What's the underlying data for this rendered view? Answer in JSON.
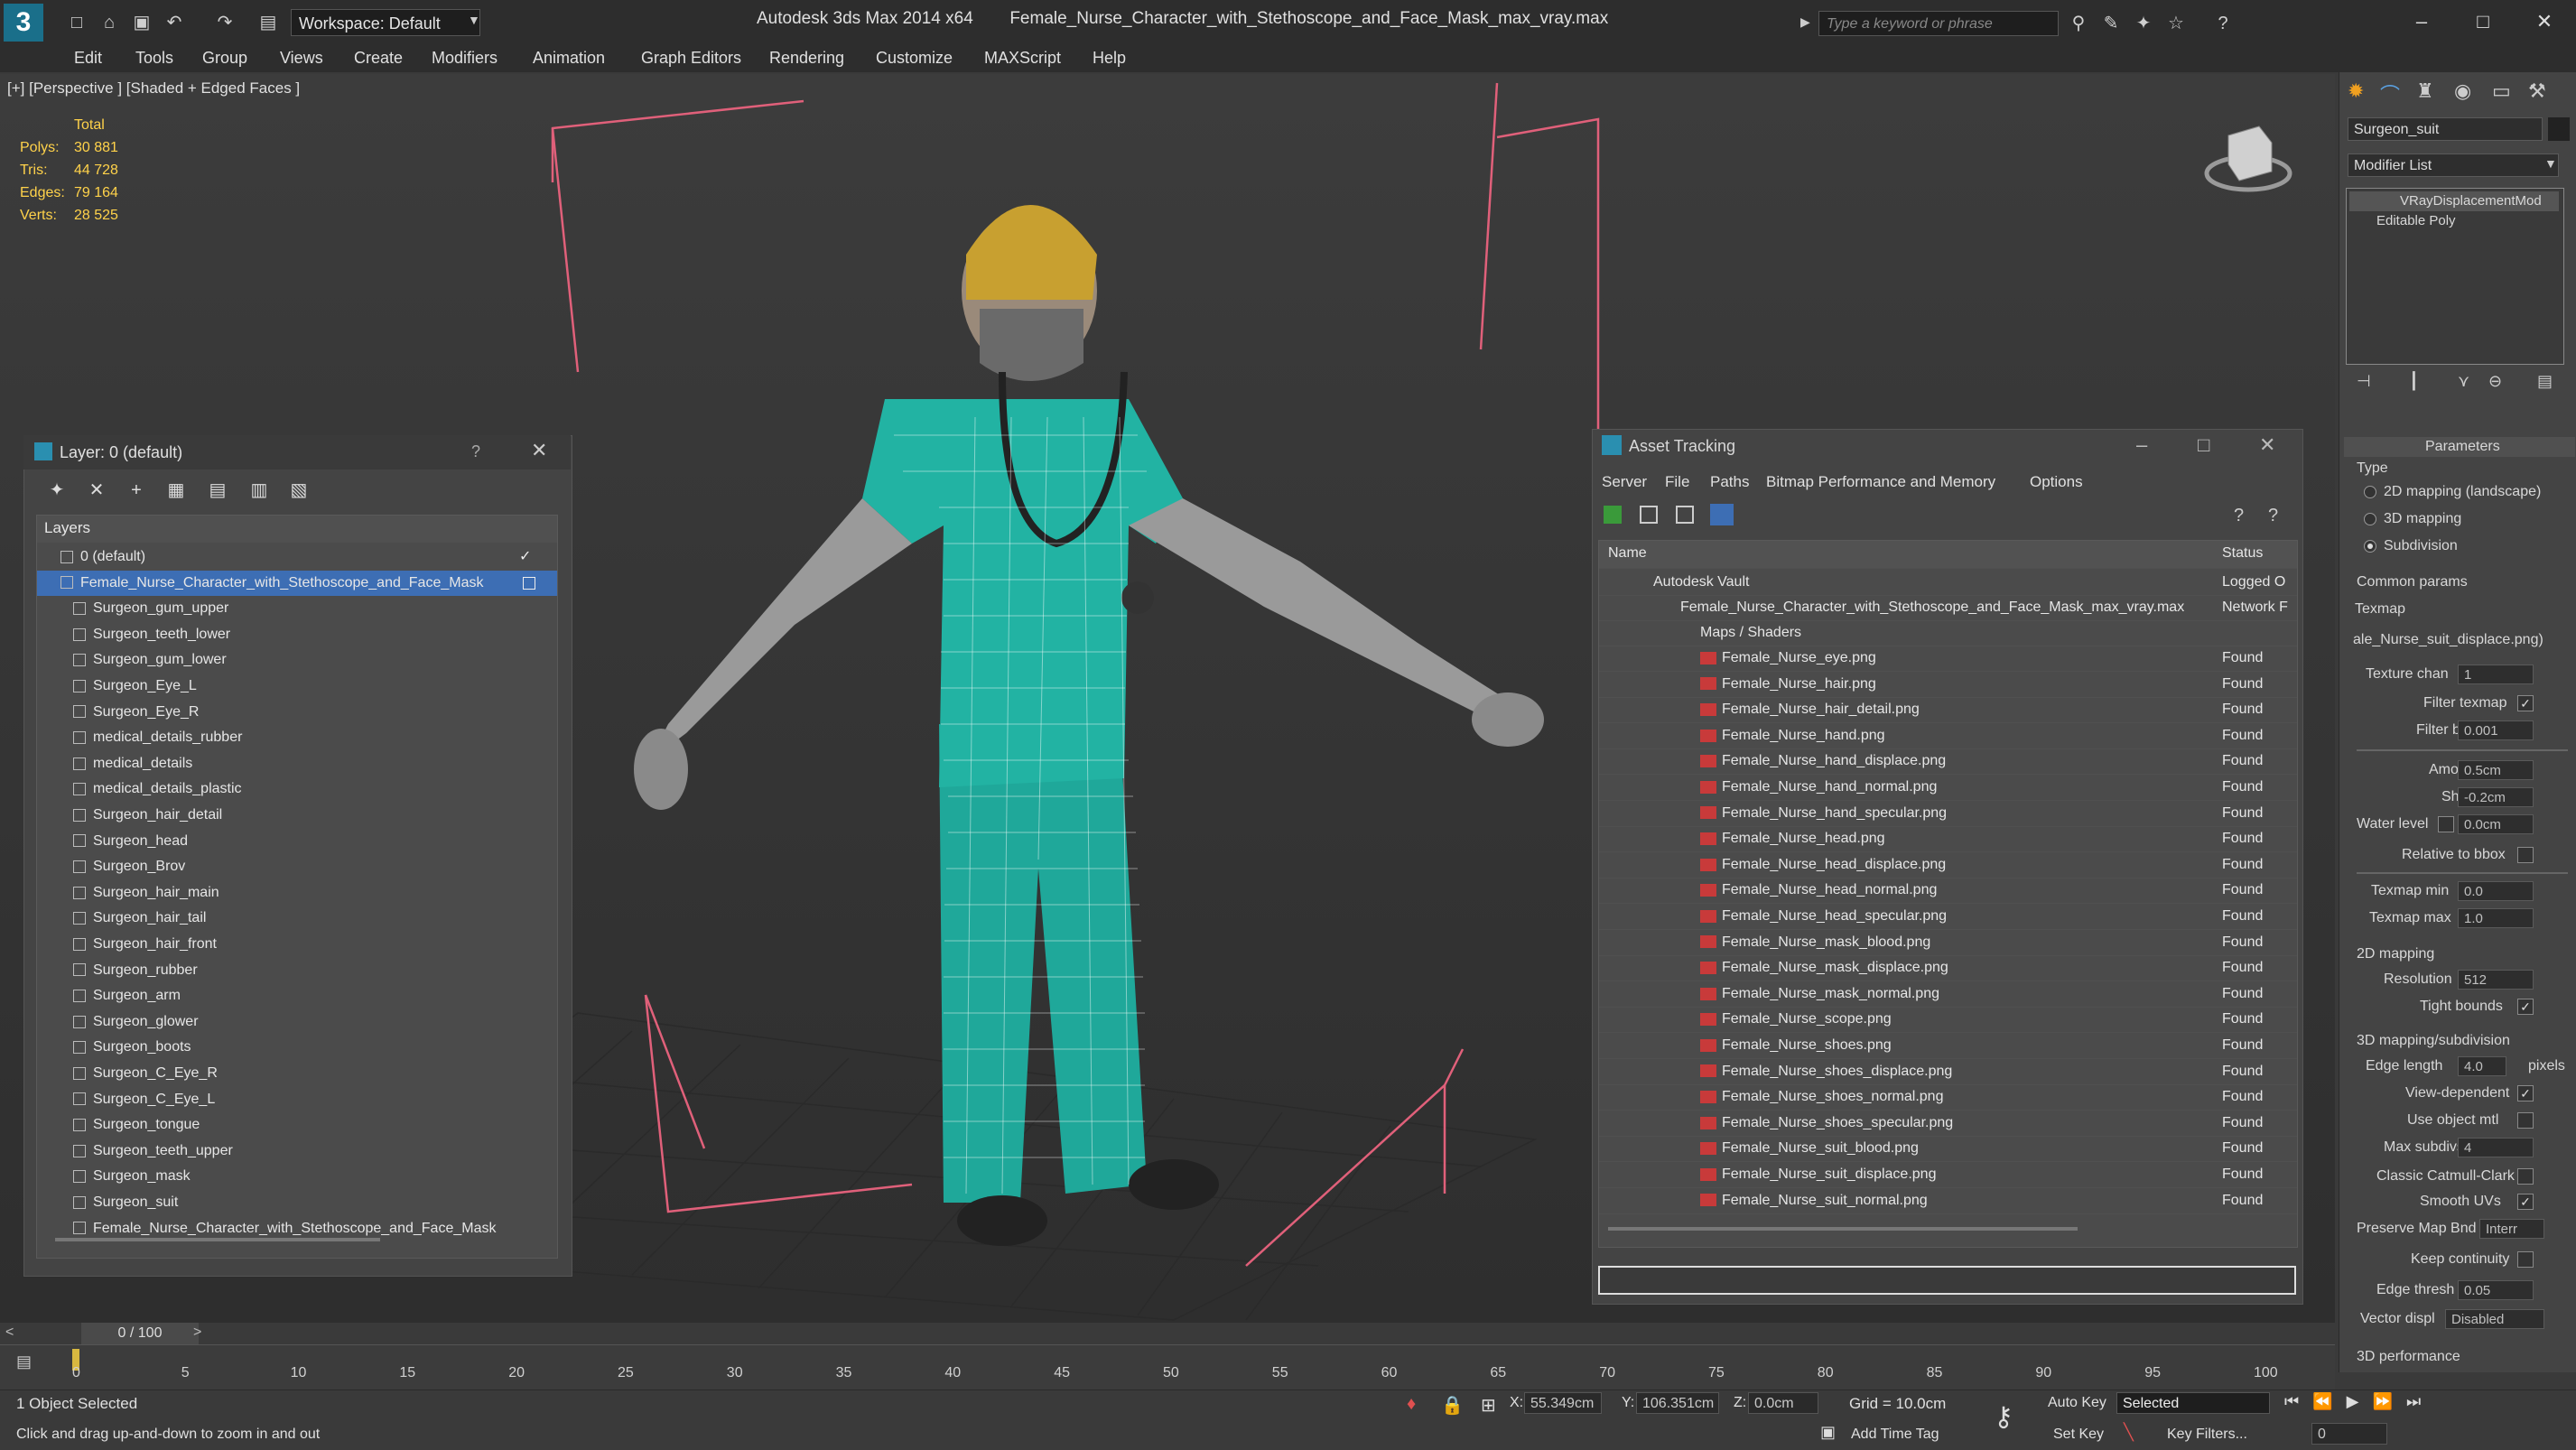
{
  "titlebar": {
    "workspace": "Workspace: Default",
    "app_name": "Autodesk 3ds Max  2014 x64",
    "file_name": "Female_Nurse_Character_with_Stethoscope_and_Face_Mask_max_vray.max",
    "search_placeholder": "Type a keyword or phrase"
  },
  "menus": [
    "Edit",
    "Tools",
    "Group",
    "Views",
    "Create",
    "Modifiers",
    "Animation",
    "Graph Editors",
    "Rendering",
    "Customize",
    "MAXScript",
    "Help"
  ],
  "viewport": {
    "label": "[+] [Perspective ] [Shaded + Edged Faces ]",
    "stats": {
      "total_label": "Total",
      "polys_label": "Polys:",
      "polys": "30 881",
      "tris_label": "Tris:",
      "tris": "44 728",
      "edges_label": "Edges:",
      "edges": "79 164",
      "verts_label": "Verts:",
      "verts": "28 525"
    }
  },
  "layer_panel": {
    "title": "Layer: 0 (default)",
    "help": "?",
    "column": "Layers",
    "items": [
      "0 (default)",
      "Female_Nurse_Character_with_Stethoscope_and_Face_Mask",
      "Surgeon_gum_upper",
      "Surgeon_teeth_lower",
      "Surgeon_gum_lower",
      "Surgeon_Eye_L",
      "Surgeon_Eye_R",
      "medical_details_rubber",
      "medical_details",
      "medical_details_plastic",
      "Surgeon_hair_detail",
      "Surgeon_head",
      "Surgeon_Brov",
      "Surgeon_hair_main",
      "Surgeon_hair_tail",
      "Surgeon_hair_front",
      "Surgeon_rubber",
      "Surgeon_arm",
      "Surgeon_glower",
      "Surgeon_boots",
      "Surgeon_C_Eye_R",
      "Surgeon_C_Eye_L",
      "Surgeon_tongue",
      "Surgeon_teeth_upper",
      "Surgeon_mask",
      "Surgeon_suit",
      "Female_Nurse_Character_with_Stethoscope_and_Face_Mask"
    ]
  },
  "asset_tracking": {
    "title": "Asset Tracking",
    "menus": [
      "Server",
      "File",
      "Paths",
      "Bitmap Performance and Memory",
      "Options"
    ],
    "col_name": "Name",
    "col_status": "Status",
    "vault": "Autodesk Vault",
    "vault_status": "Logged O",
    "max_file": "Female_Nurse_Character_with_Stethoscope_and_Face_Mask_max_vray.max",
    "max_status": "Network F",
    "maps_folder": "Maps / Shaders",
    "files": [
      "Female_Nurse_eye.png",
      "Female_Nurse_hair.png",
      "Female_Nurse_hair_detail.png",
      "Female_Nurse_hand.png",
      "Female_Nurse_hand_displace.png",
      "Female_Nurse_hand_normal.png",
      "Female_Nurse_hand_specular.png",
      "Female_Nurse_head.png",
      "Female_Nurse_head_displace.png",
      "Female_Nurse_head_normal.png",
      "Female_Nurse_head_specular.png",
      "Female_Nurse_mask_blood.png",
      "Female_Nurse_mask_displace.png",
      "Female_Nurse_mask_normal.png",
      "Female_Nurse_scope.png",
      "Female_Nurse_shoes.png",
      "Female_Nurse_shoes_displace.png",
      "Female_Nurse_shoes_normal.png",
      "Female_Nurse_shoes_specular.png",
      "Female_Nurse_suit_blood.png",
      "Female_Nurse_suit_displace.png",
      "Female_Nurse_suit_normal.png"
    ],
    "file_status": "Found"
  },
  "command_panel": {
    "object_name": "Surgeon_suit",
    "modifier_list": "Modifier List",
    "stack": [
      "VRayDisplacementMod",
      "Editable Poly"
    ],
    "parameters": "Parameters",
    "type_label": "Type",
    "type_options": [
      "2D mapping (landscape)",
      "3D mapping",
      "Subdivision"
    ],
    "common_params": "Common params",
    "texmap_label": "Texmap",
    "texmap_value": "ale_Nurse_suit_displace.png)",
    "texture_chan_label": "Texture chan",
    "texture_chan": "1",
    "filter_texmap_label": "Filter texmap",
    "filter_blur_label": "Filter blur",
    "filter_blur": "0.001",
    "amount_label": "Amount",
    "amount": "0.5cm",
    "shift_label": "Shift",
    "shift": "-0.2cm",
    "water_level_label": "Water level",
    "water_level": "0.0cm",
    "relative_bbox_label": "Relative to bbox",
    "texmap_min_label": "Texmap min",
    "texmap_min": "0.0",
    "texmap_max_label": "Texmap max",
    "texmap_max": "1.0",
    "mapping2d": "2D mapping",
    "resolution_label": "Resolution",
    "resolution": "512",
    "tight_bounds_label": "Tight bounds",
    "mapping3d": "3D mapping/subdivision",
    "edge_length_label": "Edge length",
    "edge_length": "4.0",
    "pixels": "pixels",
    "view_dependent_label": "View-dependent",
    "use_object_mtl_label": "Use object mtl",
    "max_subdivs_label": "Max subdivs",
    "max_subdivs": "4",
    "catmull_label": "Classic Catmull-Clark",
    "smooth_uvs_label": "Smooth UVs",
    "preserve_label": "Preserve Map Bnd",
    "preserve_value": "Interr",
    "keep_continuity_label": "Keep continuity",
    "edge_thresh_label": "Edge thresh",
    "edge_thresh": "0.05",
    "vector_disp_label": "Vector displ",
    "vector_disp_value": "Disabled",
    "perf": "3D performance"
  },
  "timeline": {
    "frame": "0 / 100",
    "ticks": [
      "0",
      "5",
      "10",
      "15",
      "20",
      "25",
      "30",
      "35",
      "40",
      "45",
      "50",
      "55",
      "60",
      "65",
      "70",
      "75",
      "80",
      "85",
      "90",
      "95",
      "100"
    ]
  },
  "status": {
    "selected": "1 Object Selected",
    "hint": "Click and drag up-and-down to zoom in and out",
    "x_label": "X:",
    "x": "55.349cm",
    "y_label": "Y:",
    "y": "106.351cm",
    "z_label": "Z:",
    "z": "0.0cm",
    "grid": "Grid = 10.0cm",
    "auto_key": "Auto Key",
    "selected_set": "Selected",
    "set_key": "Set Key",
    "key_filters": "Key Filters...",
    "add_time_tag": "Add Time Tag",
    "frame_field": "0"
  }
}
